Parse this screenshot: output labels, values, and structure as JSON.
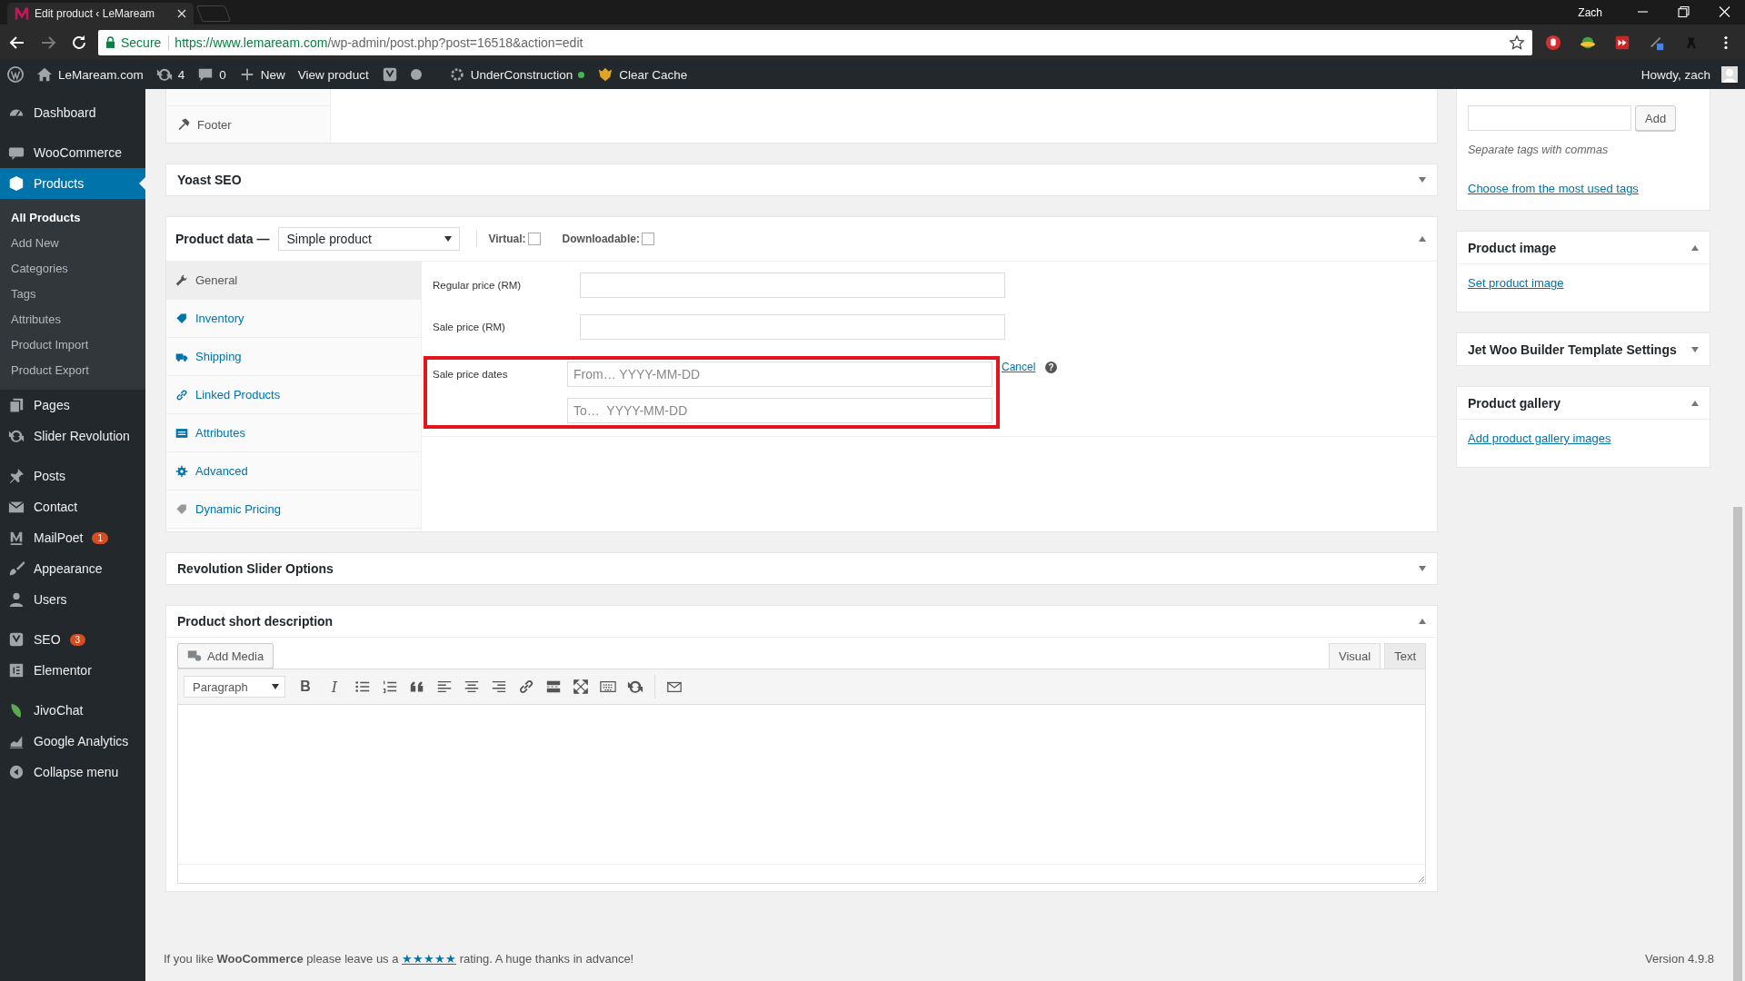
{
  "browser": {
    "tab_title": "Edit product ‹ LeMaream",
    "profile": "Zach",
    "secure": "Secure",
    "url_host": "https://www.lemaream.com",
    "url_path": "/wp-admin/post.php?post=16518&action=edit"
  },
  "admin_bar": {
    "site": "LeMaream.com",
    "updates": "4",
    "comments": "0",
    "new": "New",
    "view": "View product",
    "construction": "UnderConstruction",
    "cache": "Clear Cache",
    "howdy": "Howdy, zach"
  },
  "sidebar": {
    "groups": [
      {
        "items": [
          {
            "label": "Dashboard",
            "selected": false
          }
        ]
      },
      {
        "items": [
          {
            "label": "WooCommerce",
            "selected": false
          },
          {
            "label": "Products",
            "selected": true,
            "children": [
              {
                "label": "All Products",
                "selected": true
              },
              {
                "label": "Add New",
                "selected": false
              },
              {
                "label": "Categories",
                "selected": false
              },
              {
                "label": "Tags",
                "selected": false
              },
              {
                "label": "Attributes",
                "selected": false
              },
              {
                "label": "Product Import",
                "selected": false
              },
              {
                "label": "Product Export",
                "selected": false
              }
            ]
          },
          {
            "label": "Pages",
            "selected": false
          },
          {
            "label": "Slider Revolution",
            "selected": false
          }
        ]
      },
      {
        "items": [
          {
            "label": "Posts",
            "selected": false
          },
          {
            "label": "Contact",
            "selected": false
          },
          {
            "label": "MailPoet",
            "selected": false,
            "badge": "1"
          },
          {
            "label": "Appearance",
            "selected": false
          },
          {
            "label": "Users",
            "selected": false
          }
        ]
      },
      {
        "items": [
          {
            "label": "SEO",
            "selected": false,
            "badge": "3"
          },
          {
            "label": "Elementor",
            "selected": false
          }
        ]
      },
      {
        "items": [
          {
            "label": "JivoChat",
            "selected": false
          },
          {
            "label": "Google Analytics",
            "selected": false
          },
          {
            "label": "Collapse menu",
            "selected": false
          }
        ]
      }
    ]
  },
  "layout_box": {
    "item": "Footer"
  },
  "yoast": {
    "title": "Yoast SEO",
    "expanded": false
  },
  "product_data": {
    "title": "Product data —",
    "type": "Simple product",
    "expanded": true,
    "options": [
      {
        "label": "Virtual:",
        "checked": false
      },
      {
        "label": "Downloadable:",
        "checked": false
      }
    ],
    "tabs": [
      {
        "label": "General",
        "selected": true
      },
      {
        "label": "Inventory",
        "selected": false
      },
      {
        "label": "Shipping",
        "selected": false
      },
      {
        "label": "Linked Products",
        "selected": false
      },
      {
        "label": "Attributes",
        "selected": false
      },
      {
        "label": "Advanced",
        "selected": false
      },
      {
        "label": "Dynamic Pricing",
        "selected": false
      }
    ],
    "fields": [
      {
        "label": "Regular price (RM)"
      },
      {
        "label": "Sale price (RM)"
      }
    ],
    "dates": {
      "label": "Sale price dates",
      "from_placeholder": "From… YYYY-MM-DD",
      "to_placeholder": "To…  YYYY-MM-DD",
      "cancel": "Cancel",
      "help": "?"
    }
  },
  "revolution": {
    "title": "Revolution Slider Options",
    "expanded": false
  },
  "short_description": {
    "title": "Product short description",
    "expanded": true,
    "add_media": "Add Media",
    "modes": [
      {
        "label": "Visual",
        "selected": true
      },
      {
        "label": "Text",
        "selected": false
      }
    ],
    "format": "Paragraph",
    "bold": "B",
    "italic": "I"
  },
  "tags_box": {
    "add": "Add",
    "hint": "Separate tags with commas",
    "link": "Choose from the most used tags"
  },
  "side_boxes": [
    {
      "title": "Product image",
      "expanded": true,
      "link": "Set product image"
    },
    {
      "title": "Jet Woo Builder Template Settings",
      "expanded": false
    },
    {
      "title": "Product gallery",
      "expanded": true,
      "link": "Add product gallery images"
    }
  ],
  "footer": {
    "before": "If you like **WooCommerce** please leave us a",
    "stars": "★★★★★",
    "after": "rating. A huge thanks in advance!",
    "version": "Version 4.9.8"
  }
}
